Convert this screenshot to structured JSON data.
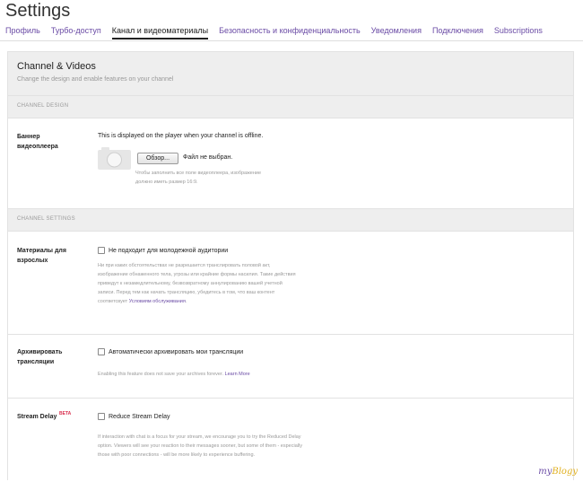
{
  "header": {
    "title": "Settings"
  },
  "tabs": [
    {
      "label": "Профиль"
    },
    {
      "label": "Турбо-доступ"
    },
    {
      "label": "Канал и видеоматериалы",
      "active": true
    },
    {
      "label": "Безопасность и конфиденциальность"
    },
    {
      "label": "Уведомления"
    },
    {
      "label": "Подключения"
    },
    {
      "label": "Subscriptions"
    }
  ],
  "card": {
    "title": "Channel & Videos",
    "subtitle": "Change the design and enable features on your channel"
  },
  "channel_design": {
    "section_label": "CHANNEL DESIGN",
    "banner": {
      "label": "Баннер видеоплеера",
      "description": "This is displayed on the player when your channel is offline.",
      "browse_label": "Обзор...",
      "file_status": "Файл не выбран.",
      "hint_line1": "Чтобы заполнить все поле видеоплеера, изображение",
      "hint_line2": "должно иметь размер 16:9."
    }
  },
  "channel_settings": {
    "section_label": "CHANNEL SETTINGS",
    "mature": {
      "label": "Материалы для взрослых",
      "checkbox_label": "Не подходит для молодежной аудитории",
      "checked": false,
      "hint_line1": "Ни при каких обстоятельствах не разрешается транслировать половой акт,",
      "hint_line2": "изображение обнаженного тела, угрозы или крайние формы насилия. Такие действия",
      "hint_line3": "приведут к незамедлительному, безвозвратному аннулированию вашей учетной",
      "hint_line4": "записи. Перед тем как начать трансляцию, убедитесь в том, что ваш контент",
      "hint_line5_prefix": "соответсвует ",
      "hint_link": "Условиям обслуживания",
      "hint_suffix": "."
    },
    "archive": {
      "label": "Архивировать трансляции",
      "checkbox_label": "Автоматически архивировать мои трансляции",
      "checked": false,
      "hint": "Enabling this feature does not save your archives forever. ",
      "hint_link": "Learn More"
    },
    "stream_delay": {
      "label": "Stream Delay",
      "beta": "BETA",
      "checkbox_label": "Reduce Stream Delay",
      "checked": false,
      "hint_line1": "If interaction with chat is a focus for your stream, we encourage you to try the Reduced Delay",
      "hint_line2": "option. Viewers will see your reaction to their messages sooner, but some of them - especially",
      "hint_line3": "those with poor connections - will be more likely to experience buffering."
    }
  },
  "watermark": {
    "part1": "my",
    "part2": "Blogy"
  }
}
